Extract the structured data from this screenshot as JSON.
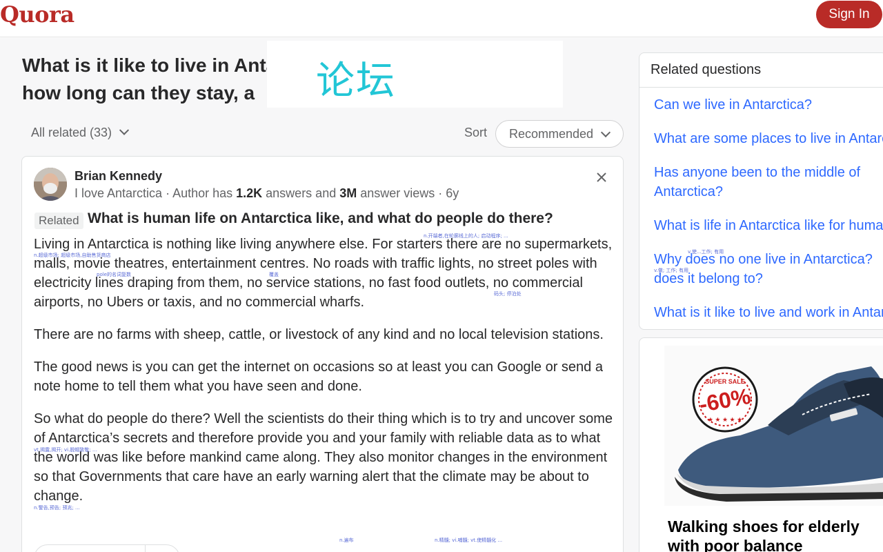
{
  "header": {
    "logo": "Quora",
    "sign_in_label": "Sign In"
  },
  "overlay": {
    "text": "论坛"
  },
  "question": {
    "title_line1": "What is it like to live in Antarctica? If people live there,",
    "title_line2": "how long can they stay, a"
  },
  "filters": {
    "all_related": "All related (33)",
    "sort_label": "Sort",
    "sort_value": "Recommended"
  },
  "answer": {
    "author_name": "Brian Kennedy",
    "meta_prefix": "I love Antarctica · Author has ",
    "meta_answers": "1.2K",
    "meta_mid": " answers and ",
    "meta_views": "3M",
    "meta_suffix": " answer views · 6y",
    "related_tag": "Related",
    "related_question": "What is human life on Antarctica like, and what do people do there?",
    "paragraphs": [
      "Living in Antarctica is nothing like living anywhere else. For starters there are no supermarkets, malls, movie theatres, entertainment centres. No roads with traffic lights, no street poles with electricity lines draping from them, no service stations, no fast food outlets, no commercial airports, no Ubers or taxis, and no commercial wharfs.",
      "There are no farms with sheep, cattle, or livestock of any kind and no local television stations.",
      "The good news is you can get the internet on occasions so at least you can Google or send a note home to tell them what you have seen and done.",
      "So what do people do there? Well the scientists do their thing which is to try and uncover some of Antarctica’s secrets and therefore provide you and your family with reliable data as to what the world was like before mankind came along. They also monitor changes in the environment so that Governments that care have an early warning alert that the climate may be about to change."
    ],
    "annotations": {
      "a1": "n.开端者,在轮廓线上的人; 启动程序; ...",
      "a2": "n.超级市场; 超级市场,自助售货商店",
      "a3": "pole的名词复数",
      "a4": "覆盖",
      "a5": "码头; 停泊处",
      "a6": "vt.揭露,揭开; vi.脱帽致敬; ...",
      "a7": "n.警告,预告; 预兆; ...",
      "a8": "n.遍布",
      "a9": "n.精髓; vi.哺髓; vt.使精髓化 ..."
    }
  },
  "related": {
    "header": "Related questions",
    "items": [
      "Can we live in Antarctica?",
      "What are some places to live in Antarctica?",
      "Has anyone been to the middle of",
      "Antarctica?",
      "What is life in Antarctica like for humans?",
      "Why does no one live in Antarctica?",
      "does it belong to?",
      "What is it like to live and work in Antarctica?"
    ],
    "annotations": {
      "b1": "v.使...工作; 有用",
      "b2": "v.做; 工作; 有用"
    }
  },
  "ad": {
    "badge_top": "SUPER SALE",
    "badge_value": "-60%",
    "title_line1": "Walking shoes for elderly",
    "title_line2": "with poor balance"
  },
  "colors": {
    "brand": "#b92b27",
    "link": "#2e69ff",
    "overlay_text": "#22c6d6"
  }
}
